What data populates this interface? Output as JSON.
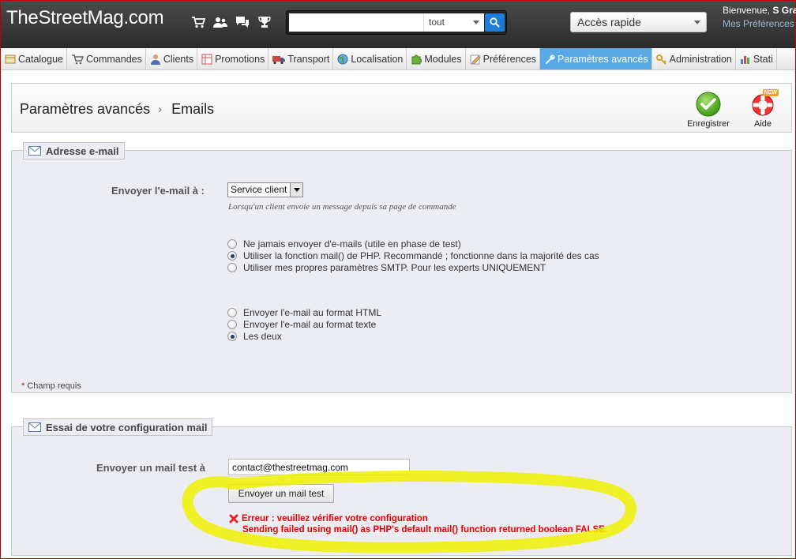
{
  "header": {
    "logo": "TheStreetMag.com",
    "search": {
      "value": "",
      "placeholder": "",
      "scope": "tout"
    },
    "quick_access": "Accès rapide",
    "welcome_prefix": "Bienvenue, ",
    "welcome_name": "S Gra",
    "prefs_link": "Mes Préférences"
  },
  "tabs": [
    {
      "label": "Catalogue",
      "icon": "catalogue-icon"
    },
    {
      "label": "Commandes",
      "icon": "cart-icon"
    },
    {
      "label": "Clients",
      "icon": "customers-icon"
    },
    {
      "label": "Promotions",
      "icon": "promotions-icon"
    },
    {
      "label": "Transport",
      "icon": "truck-icon"
    },
    {
      "label": "Localisation",
      "icon": "globe-icon"
    },
    {
      "label": "Modules",
      "icon": "puzzle-icon"
    },
    {
      "label": "Préférences",
      "icon": "preferences-icon"
    },
    {
      "label": "Paramètres avancés",
      "icon": "wrench-icon",
      "active": true
    },
    {
      "label": "Administration",
      "icon": "key-icon"
    },
    {
      "label": "Stati",
      "icon": "stats-icon"
    }
  ],
  "page": {
    "breadcrumb_parent": "Paramètres avancés",
    "breadcrumb_sep": "›",
    "breadcrumb_current": "Emails",
    "save_label": "Enregistrer",
    "help_label": "Aide",
    "help_badge": "NEW"
  },
  "email_section": {
    "legend": "Adresse e-mail",
    "send_to_label": "Envoyer l'e-mail à :",
    "send_to_value": "Service client",
    "send_to_hint": "Lorsqu'un client envoie un message depuis sa page de commande",
    "method_options": [
      {
        "label": "Ne jamais envoyer d'e-mails (utile en phase de test)",
        "checked": false
      },
      {
        "label": "Utiliser la fonction mail() de PHP. Recommandé ; fonctionne dans la majorité des cas",
        "checked": true
      },
      {
        "label": "Utiliser mes propres paramètres SMTP. Pour les experts UNIQUEMENT",
        "checked": false
      }
    ],
    "format_options": [
      {
        "label": "Envoyer l'e-mail au format HTML",
        "checked": false
      },
      {
        "label": "Envoyer l'e-mail au format texte",
        "checked": false
      },
      {
        "label": "Les deux",
        "checked": true
      }
    ],
    "required_star": "*",
    "required_text": " Champ requis"
  },
  "test_section": {
    "legend": "Essai de votre configuration mail",
    "test_label": "Envoyer un mail test à",
    "test_email": "contact@thestreetmag.com",
    "send_button": "Envoyer un mail test",
    "error_title": "Erreur : veuillez vérifier votre configuration",
    "error_detail": "Sending failed using mail() as PHP's default mail() function returned boolean FALSE."
  },
  "colors": {
    "header_bg": "#333333",
    "active_tab": "#58a9e6",
    "panel_bg": "#ebedf3",
    "error": "#ee0000",
    "highlight": "#f0f000"
  }
}
